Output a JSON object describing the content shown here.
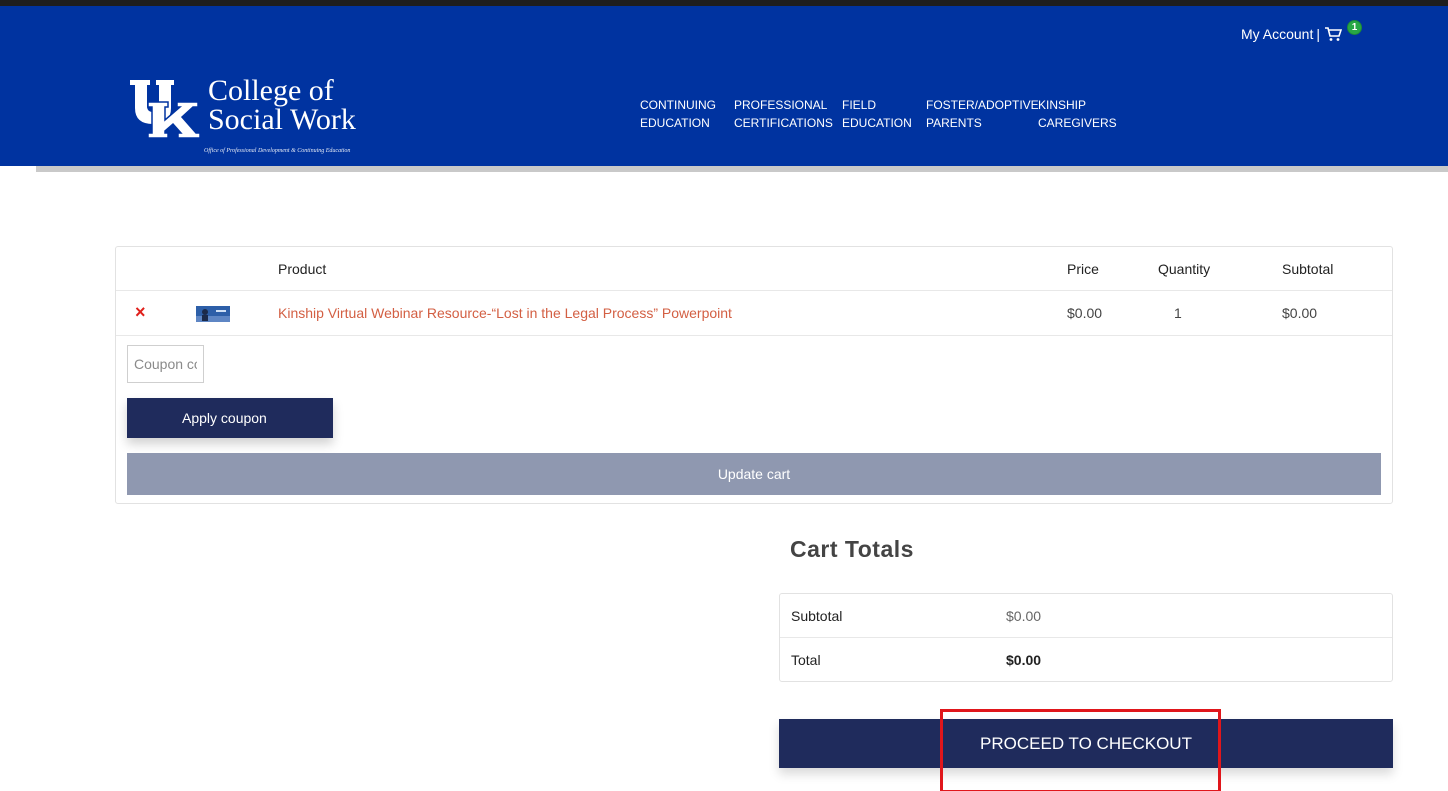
{
  "header": {
    "account_link": "My Account",
    "separator": "|",
    "cart_count": "1",
    "logo": {
      "line1": "College of",
      "line2": "Social Work",
      "tagline": "Office of Professional Development & Continuing Education"
    },
    "nav": [
      {
        "line1": "CONTINUING",
        "line2": "EDUCATION"
      },
      {
        "line1": "PROFESSIONAL",
        "line2": "CERTIFICATIONS"
      },
      {
        "line1": "FIELD",
        "line2": "EDUCATION"
      },
      {
        "line1": "FOSTER/ADOPTIVE",
        "line2": "PARENTS"
      },
      {
        "line1": "KINSHIP",
        "line2": "CAREGIVERS"
      }
    ],
    "colors": {
      "brand": "#0033a0",
      "badge": "#28a745"
    }
  },
  "cart": {
    "columns": {
      "product": "Product",
      "price": "Price",
      "quantity": "Quantity",
      "subtotal": "Subtotal"
    },
    "items": [
      {
        "remove": "×",
        "thumbnail": "webinar-thumbnail",
        "product": "Kinship Virtual Webinar Resource-“Lost in the Legal Process” Powerpoint",
        "price": "$0.00",
        "quantity": "1",
        "subtotal": "$0.00"
      }
    ],
    "coupon_placeholder": "Coupon code",
    "apply_coupon": "Apply coupon",
    "update_cart": "Update cart"
  },
  "totals": {
    "title": "Cart Totals",
    "subtotal_label": "Subtotal",
    "subtotal_value": "$0.00",
    "total_label": "Total",
    "total_value": "$0.00",
    "checkout": "PROCEED TO CHECKOUT",
    "colors": {
      "button": "#1f2b5c",
      "highlight": "#e0161b"
    }
  }
}
